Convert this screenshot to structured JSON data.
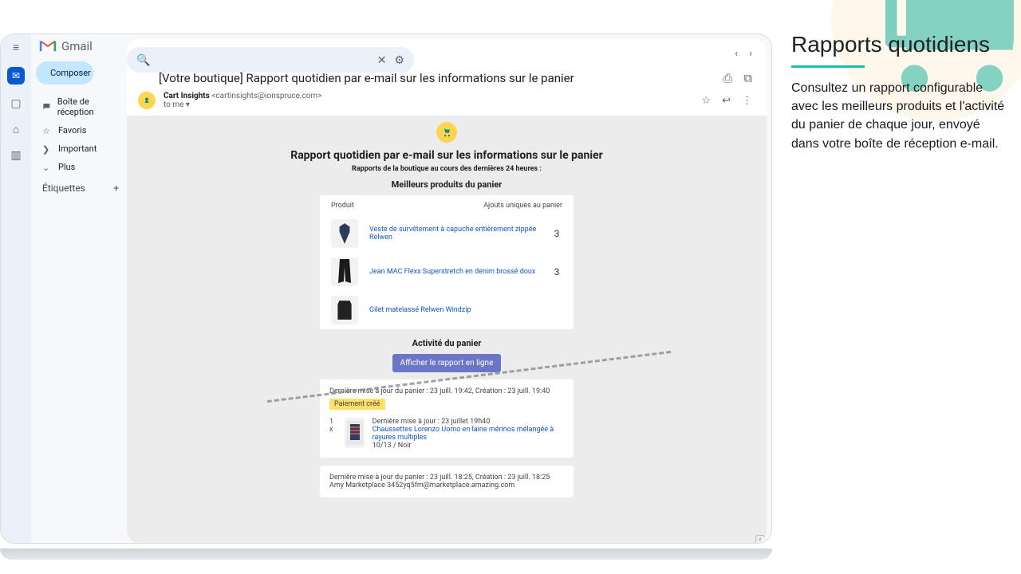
{
  "gmail": {
    "product": "Gmail",
    "compose": "Composer",
    "sidebar": [
      {
        "icon": "inbox",
        "label": "Boîte de réception"
      },
      {
        "icon": "star",
        "label": "Favoris"
      },
      {
        "icon": "important",
        "label": "Important"
      },
      {
        "icon": "chevron",
        "label": "Plus"
      }
    ],
    "labels_header": "Étiquettes",
    "search_placeholder": ""
  },
  "email": {
    "subject": "[Votre boutique] Rapport quotidien par e-mail sur les informations sur le panier",
    "sender_name": "Cart Insights",
    "sender_email": "<cartinsights@ionspruce.com>",
    "to": "to me",
    "body": {
      "title": "Rapport quotidien par e-mail sur les informations sur le panier",
      "subtitle": "Rapports de la boutique au cours des dernières 24 heures :",
      "top_products_heading": "Meilleurs produits du panier",
      "table_head_product": "Produit",
      "table_head_count": "Ajouts uniques au panier",
      "products": [
        {
          "name": "Veste de survêtement à capuche entièrement zippée Relwen",
          "count": "3",
          "color": "#2b3a55"
        },
        {
          "name": "Jean MAC Flexx Superstretch en denim brossé doux",
          "count": "3",
          "color": "#1b1b1b"
        },
        {
          "name": "Gilet matelassé Relwen Windzip",
          "count": "",
          "color": "#222"
        }
      ],
      "activity_heading": "Activité du panier",
      "view_report": "Afficher le rapport en ligne",
      "activity1": {
        "meta": "Dernière mise à jour du panier : 23 juill. 19:42, Création : 23 juill. 19:40",
        "chip": "Paiement créé",
        "qty": "1 x",
        "update_line": "Dernière mise à jour : 23 juillet 19h40",
        "product": "Chaussettes Lorenzo Uomo en laine mérinos mélangée à rayures multiples",
        "variant": "10/13 / Noir"
      },
      "activity2": {
        "meta": "Dernière mise à jour du panier : 23 juill. 18:25, Création : 23 juill. 18:25",
        "customer": "Amy Marketplace 3452yq5fm@marketplace.amazing.com"
      }
    }
  },
  "panel": {
    "title": "Rapports quotidiens",
    "body": "Consultez un rapport configurable avec les meilleurs produits et l'activité du panier de chaque jour, envoyé dans votre boîte de réception e-mail."
  }
}
